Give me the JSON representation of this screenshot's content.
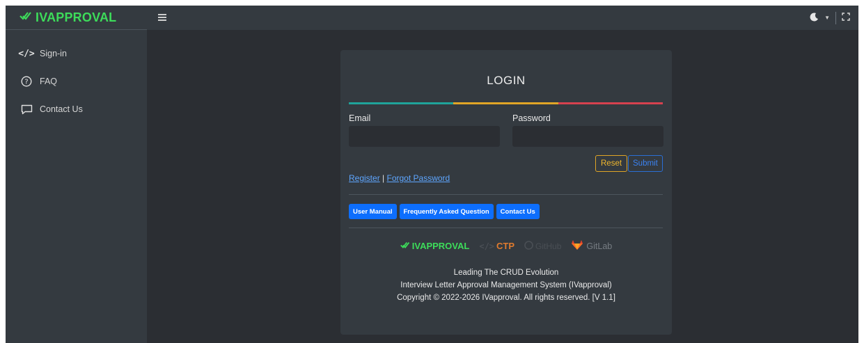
{
  "brand": {
    "name": "IVAPPROVAL",
    "color": "#3ddc5a"
  },
  "topbar": {
    "menu_icon": "hamburger-icon",
    "theme_icon": "moon-icon",
    "fullscreen_icon": "fullscreen-icon"
  },
  "sidebar": {
    "items": [
      {
        "label": "Sign-in",
        "icon": "code-icon"
      },
      {
        "label": "FAQ",
        "icon": "question-circle-icon"
      },
      {
        "label": "Contact Us",
        "icon": "chat-icon"
      }
    ]
  },
  "login": {
    "title": "LOGIN",
    "email_label": "Email",
    "email_value": "",
    "password_label": "Password",
    "password_value": "",
    "reset_label": "Reset",
    "submit_label": "Submit",
    "register_link": "Register",
    "separator": "|",
    "forgot_link": "Forgot Password",
    "rainbow_colors": [
      "#1fa39a",
      "#e0a526",
      "#d6414f"
    ]
  },
  "quick_links": [
    "User Manual",
    "Frequently Asked Question",
    "Contact Us"
  ],
  "logos": {
    "ivapproval": "IVAPPROVAL",
    "ctp": "CTP",
    "github": "GitHub",
    "gitlab": "GitLab"
  },
  "footer": {
    "tagline": "Leading The CRUD Evolution",
    "system": "Interview Letter Approval Management System (IVapproval)",
    "copyright": "Copyright © 2022-2026 IVapproval. All rights reserved. [V 1.1]"
  }
}
